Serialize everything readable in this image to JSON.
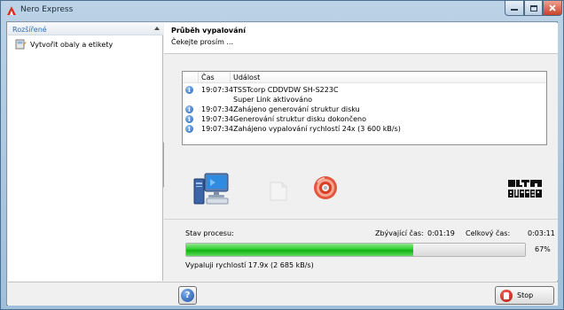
{
  "window": {
    "title": "Nero Express"
  },
  "sidebar": {
    "header": "Rozšířené",
    "items": [
      {
        "label": "Vytvořit obaly a etikety",
        "icon": "cover-designer-icon"
      }
    ]
  },
  "main": {
    "title": "Průběh vypalování",
    "subtitle": "Čekejte prosím ...",
    "log": {
      "columns": [
        "Čas",
        "Událost"
      ],
      "rows": [
        {
          "icon": "info-icon",
          "time": "19:07:34",
          "event": "TSSTcorp CDDVDW SH-S223C"
        },
        {
          "icon": "",
          "time": "",
          "event": "Super Link aktivováno"
        },
        {
          "icon": "info-icon",
          "time": "19:07:34",
          "event": "Zahájeno generování struktur disku"
        },
        {
          "icon": "info-icon",
          "time": "19:07:34",
          "event": "Generování struktur disku dokončeno"
        },
        {
          "icon": "info-icon",
          "time": "19:07:34",
          "event": "Zahájeno vypalování rychlostí 24x (3 600 kB/s)"
        }
      ]
    },
    "progress": {
      "status_label": "Stav procesu:",
      "remaining_label": "Zbývající čas:",
      "remaining_value": "0:01:19",
      "total_label": "Celkový čas:",
      "total_value": "0:03:11",
      "percent": 67,
      "percent_text": "67%",
      "speed_text": "Vypaluji rychlostí 17.9x (2 685 kB/s)"
    }
  },
  "footer": {
    "stop_label": "Stop"
  },
  "colors": {
    "progress_green": "#1ec21e",
    "sidebar_header_text": "#2e6db3"
  }
}
